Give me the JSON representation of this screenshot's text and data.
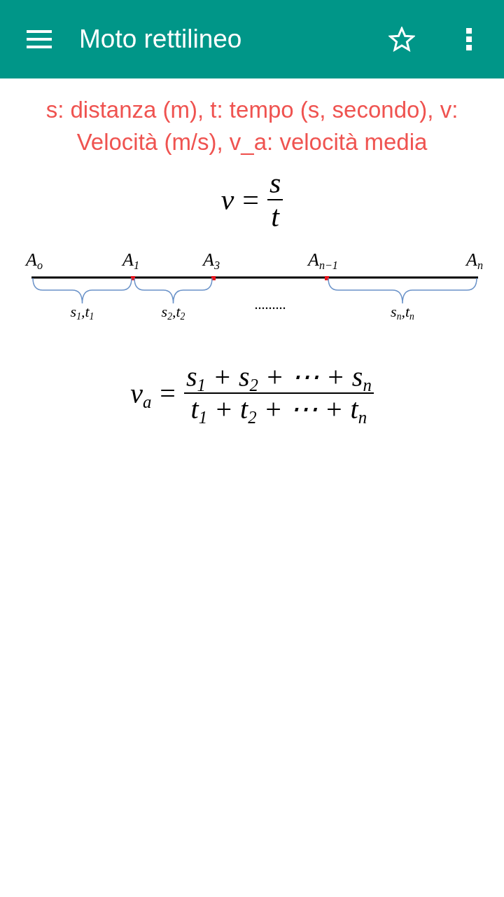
{
  "app_bar": {
    "title": "Moto rettilineo",
    "starred": false
  },
  "legend": "s: distanza (m), t: tempo (s, secondo), v: Velocità (m/s), v_a: velocità media",
  "blocks": [
    {
      "kind": "formula",
      "lhs": "v",
      "relation": "=",
      "numerator": "s",
      "denominator": "t"
    },
    {
      "kind": "diagram",
      "points": [
        {
          "label": "A$_{o}$",
          "marked": false
        },
        {
          "label": "A$_{1}$",
          "marked": true
        },
        {
          "label": "A$_{3}$",
          "marked": true
        },
        {
          "label": "A$_{n−1}$",
          "marked": true
        },
        {
          "label": "A$_{n}$",
          "marked": false
        }
      ],
      "segments": [
        {
          "kind": "brace",
          "label": "s$_{1}$,t$_{1}$"
        },
        {
          "kind": "brace",
          "label": "s$_{2}$,t$_{2}$"
        },
        {
          "kind": "ellipsis",
          "label": "........."
        },
        {
          "kind": "brace",
          "label": "s$_{n}$,t$_{n}$"
        }
      ]
    },
    {
      "kind": "formula",
      "lhs": "v$_{a}$",
      "relation": "=",
      "numerator": "s$_{1}$ + s$_{2}$ + ⋯ + s$_{n}$",
      "denominator": "t$_{1}$ + t$_{2}$ + ⋯ + t$_{n}$"
    }
  ]
}
